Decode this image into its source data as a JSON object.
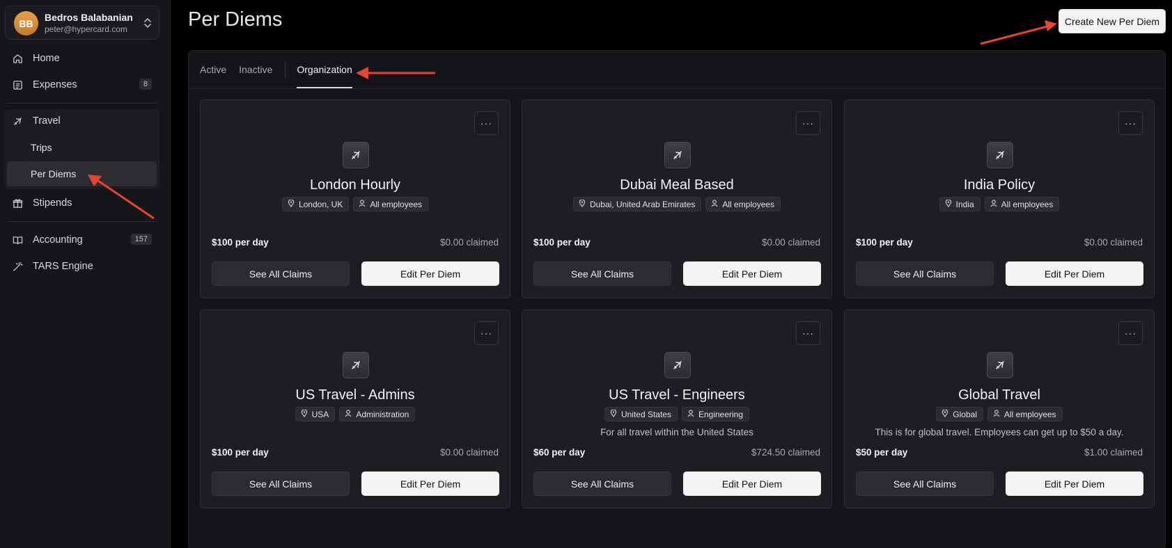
{
  "user": {
    "initials": "BB",
    "name": "Bedros Balabanian",
    "email": "peter@hypercard.com"
  },
  "nav": {
    "home": "Home",
    "expenses": "Expenses",
    "expenses_badge": "8",
    "travel": "Travel",
    "trips": "Trips",
    "per_diems": "Per Diems",
    "stipends": "Stipends",
    "accounting": "Accounting",
    "accounting_badge": "157",
    "tars": "TARS Engine"
  },
  "page": {
    "title": "Per Diems",
    "create_button": "Create New Per Diem"
  },
  "tabs": [
    "Active",
    "Inactive",
    "Organization"
  ],
  "active_tab": "Organization",
  "cards": [
    {
      "title": "London Hourly",
      "location": "London, UK",
      "audience": "All employees",
      "description": "",
      "rate": "$100 per day",
      "claimed": "$0.00 claimed",
      "see_claims": "See All Claims",
      "edit": "Edit Per Diem",
      "more": "···"
    },
    {
      "title": "Dubai Meal Based",
      "location": "Dubai, United Arab Emirates",
      "audience": "All employees",
      "description": "",
      "rate": "$100 per day",
      "claimed": "$0.00 claimed",
      "see_claims": "See All Claims",
      "edit": "Edit Per Diem",
      "more": "···"
    },
    {
      "title": "India Policy",
      "location": "India",
      "audience": "All employees",
      "description": "",
      "rate": "$100 per day",
      "claimed": "$0.00 claimed",
      "see_claims": "See All Claims",
      "edit": "Edit Per Diem",
      "more": "···"
    },
    {
      "title": "US Travel - Admins",
      "location": "USA",
      "audience": "Administration",
      "description": "",
      "rate": "$100 per day",
      "claimed": "$0.00 claimed",
      "see_claims": "See All Claims",
      "edit": "Edit Per Diem",
      "more": "···"
    },
    {
      "title": "US Travel - Engineers",
      "location": "United States",
      "audience": "Engineering",
      "description": "For all travel within the United States",
      "rate": "$60 per day",
      "claimed": "$724.50 claimed",
      "see_claims": "See All Claims",
      "edit": "Edit Per Diem",
      "more": "···"
    },
    {
      "title": "Global Travel",
      "location": "Global",
      "audience": "All employees",
      "description": "This is for global travel. Employees can get up to $50 a day.",
      "rate": "$50 per day",
      "claimed": "$1.00 claimed",
      "see_claims": "See All Claims",
      "edit": "Edit Per Diem",
      "more": "···"
    }
  ],
  "colors": {
    "annotation_arrow": "#e8452a",
    "background": "#000000",
    "card": "#1d1e22"
  }
}
